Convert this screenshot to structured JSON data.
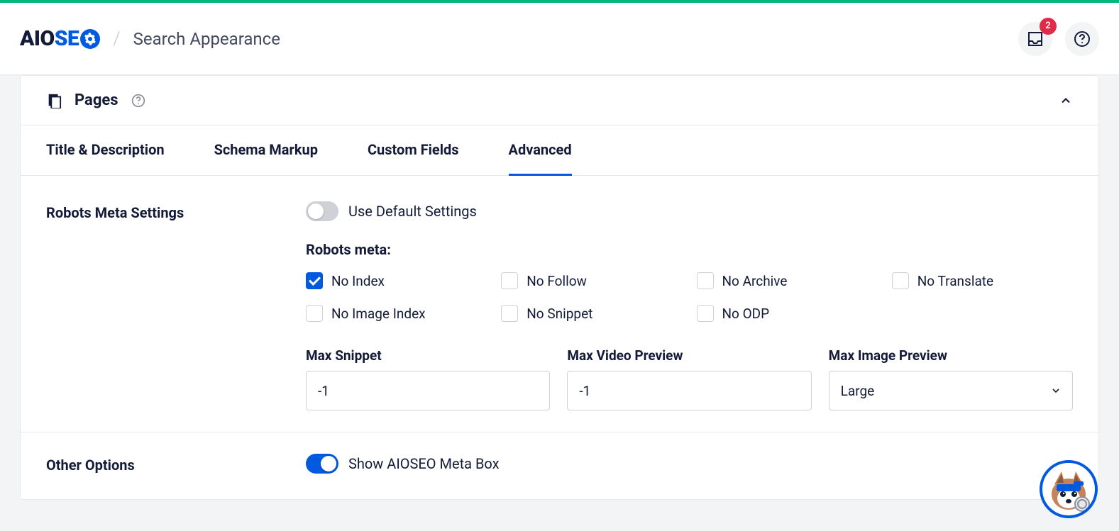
{
  "header": {
    "logo_prefix": "AIO",
    "logo_suffix": "SE",
    "breadcrumb": "Search Appearance",
    "notification_count": "2"
  },
  "section": {
    "title": "Pages"
  },
  "tabs": [
    {
      "label": "Title & Description"
    },
    {
      "label": "Schema Markup"
    },
    {
      "label": "Custom Fields"
    },
    {
      "label": "Advanced"
    }
  ],
  "robots": {
    "section_label": "Robots Meta Settings",
    "default_toggle_label": "Use Default Settings",
    "default_toggle_on": false,
    "meta_heading": "Robots meta:",
    "checks": [
      {
        "label": "No Index",
        "checked": true
      },
      {
        "label": "No Follow",
        "checked": false
      },
      {
        "label": "No Archive",
        "checked": false
      },
      {
        "label": "No Translate",
        "checked": false
      },
      {
        "label": "No Image Index",
        "checked": false
      },
      {
        "label": "No Snippet",
        "checked": false
      },
      {
        "label": "No ODP",
        "checked": false
      }
    ],
    "inputs": {
      "max_snippet": {
        "label": "Max Snippet",
        "value": "-1"
      },
      "max_video": {
        "label": "Max Video Preview",
        "value": "-1"
      },
      "max_image": {
        "label": "Max Image Preview",
        "value": "Large"
      }
    }
  },
  "other": {
    "section_label": "Other Options",
    "meta_box_label": "Show AIOSEO Meta Box",
    "meta_box_on": true
  }
}
